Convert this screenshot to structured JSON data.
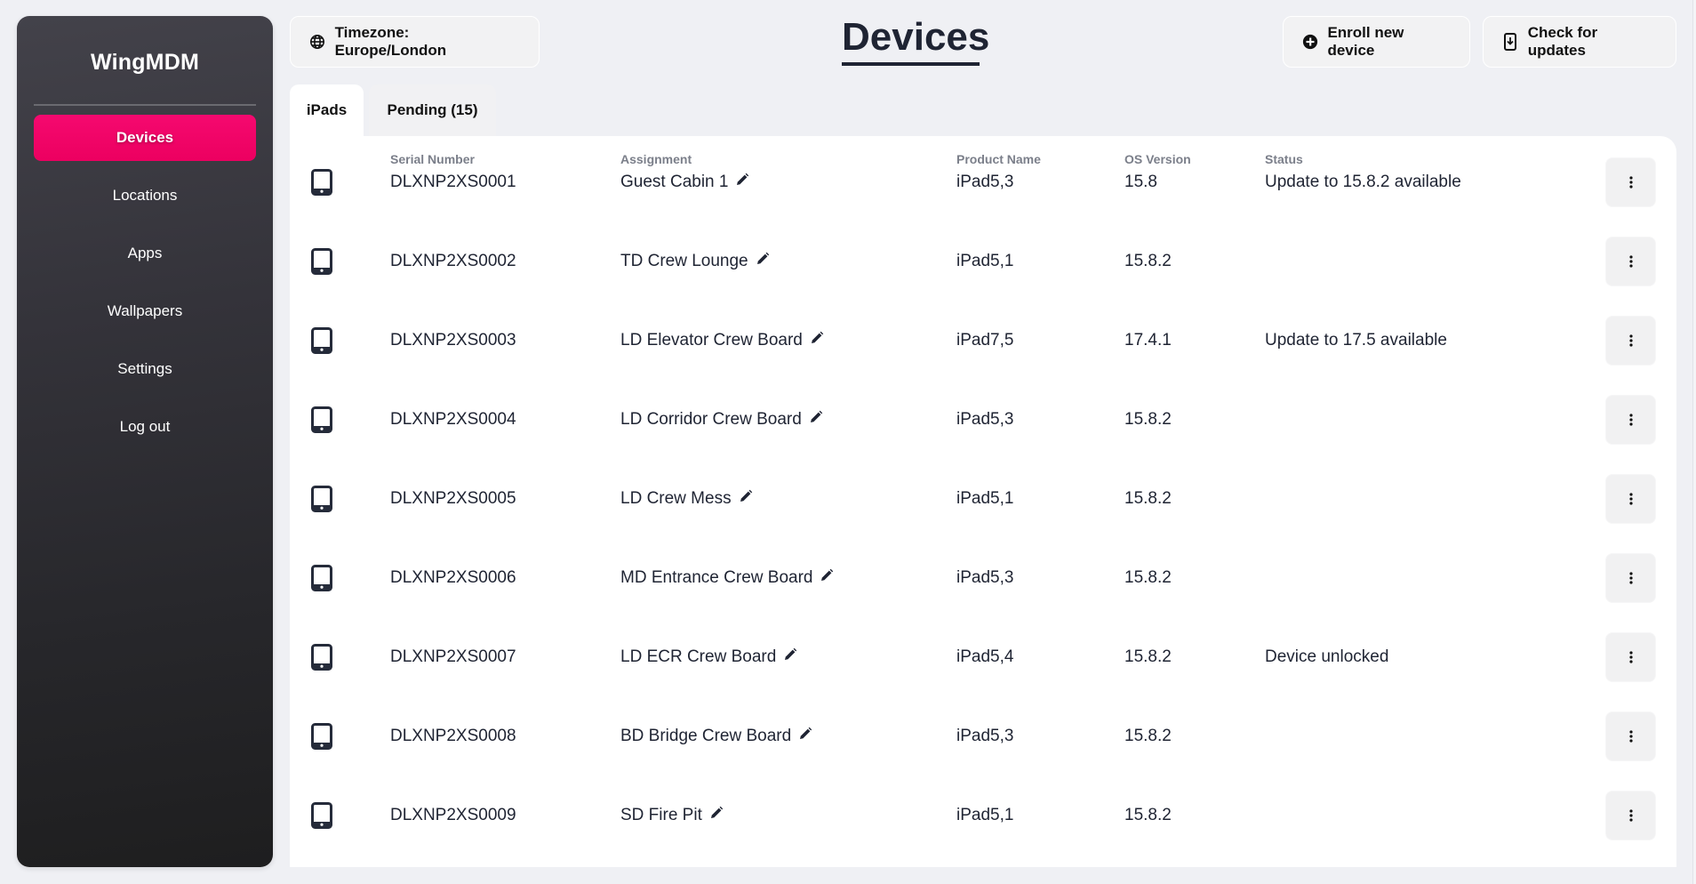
{
  "app": {
    "brand": "WingMDM"
  },
  "sidebar": {
    "items": [
      {
        "label": "Devices",
        "active": true
      },
      {
        "label": "Locations",
        "active": false
      },
      {
        "label": "Apps",
        "active": false
      },
      {
        "label": "Wallpapers",
        "active": false
      },
      {
        "label": "Settings",
        "active": false
      },
      {
        "label": "Log out",
        "active": false
      }
    ]
  },
  "header": {
    "title": "Devices",
    "timezone_button": {
      "label": "Timezone: Europe/London",
      "icon": "globe-icon"
    },
    "enroll_button": {
      "label": "Enroll new device",
      "icon": "plus-circle-icon"
    },
    "updates_button": {
      "label": "Check for updates",
      "icon": "phone-download-icon"
    }
  },
  "tabs": [
    {
      "label": "iPads",
      "active": true
    },
    {
      "label": "Pending (15)",
      "active": false
    }
  ],
  "table": {
    "columns": [
      "",
      "Serial Number",
      "Assignment",
      "Product Name",
      "OS Version",
      "Status",
      ""
    ],
    "rows": [
      {
        "serial": "DLXNP2XS0001",
        "assignment": "Guest Cabin 1",
        "product": "iPad5,3",
        "os": "15.8",
        "status": "Update to 15.8.2 available"
      },
      {
        "serial": "DLXNP2XS0002",
        "assignment": "TD Crew Lounge",
        "product": "iPad5,1",
        "os": "15.8.2",
        "status": ""
      },
      {
        "serial": "DLXNP2XS0003",
        "assignment": "LD Elevator Crew Board",
        "product": "iPad7,5",
        "os": "17.4.1",
        "status": "Update to 17.5 available"
      },
      {
        "serial": "DLXNP2XS0004",
        "assignment": "LD Corridor Crew Board",
        "product": "iPad5,3",
        "os": "15.8.2",
        "status": ""
      },
      {
        "serial": "DLXNP2XS0005",
        "assignment": "LD Crew Mess",
        "product": "iPad5,1",
        "os": "15.8.2",
        "status": ""
      },
      {
        "serial": "DLXNP2XS0006",
        "assignment": "MD Entrance Crew Board",
        "product": "iPad5,3",
        "os": "15.8.2",
        "status": ""
      },
      {
        "serial": "DLXNP2XS0007",
        "assignment": "LD ECR Crew Board",
        "product": "iPad5,4",
        "os": "15.8.2",
        "status": "Device unlocked"
      },
      {
        "serial": "DLXNP2XS0008",
        "assignment": "BD Bridge Crew Board",
        "product": "iPad5,3",
        "os": "15.8.2",
        "status": ""
      },
      {
        "serial": "DLXNP2XS0009",
        "assignment": "SD Fire Pit",
        "product": "iPad5,1",
        "os": "15.8.2",
        "status": ""
      }
    ]
  },
  "colors": {
    "accent": "#f1076a",
    "sidebar_top": "#43424a",
    "sidebar_bottom": "#1e1e1f",
    "title": "#1f2433",
    "background": "#eff0f4"
  }
}
